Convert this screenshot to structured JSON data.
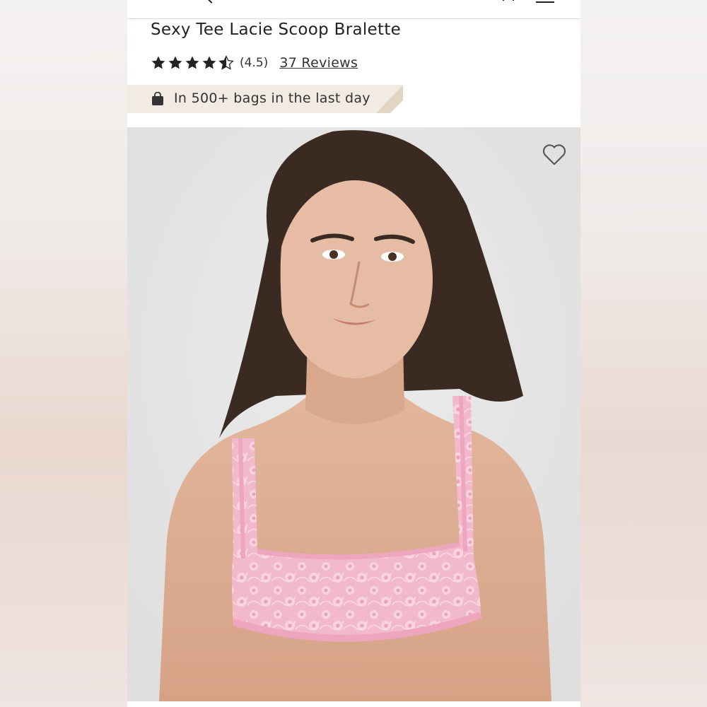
{
  "product": {
    "title": "Sexy Tee Lacie Scoop Bralette",
    "rating": 4.5,
    "rating_text": "(4.5)",
    "reviews_label": "37 Reviews"
  },
  "badge": {
    "icon": "shopping-bag-icon",
    "text": "In 500+ bags in the last day"
  },
  "image": {
    "wishlist_icon": "heart-outline-icon",
    "description": "model wearing pink lace scoop bralette"
  },
  "colors": {
    "badge_background": "#f2ebe3",
    "badge_accent": "#e2d5c4",
    "brand_red": "#c8102e",
    "text": "#222222",
    "bralette_pink": "#f0b6ca"
  }
}
